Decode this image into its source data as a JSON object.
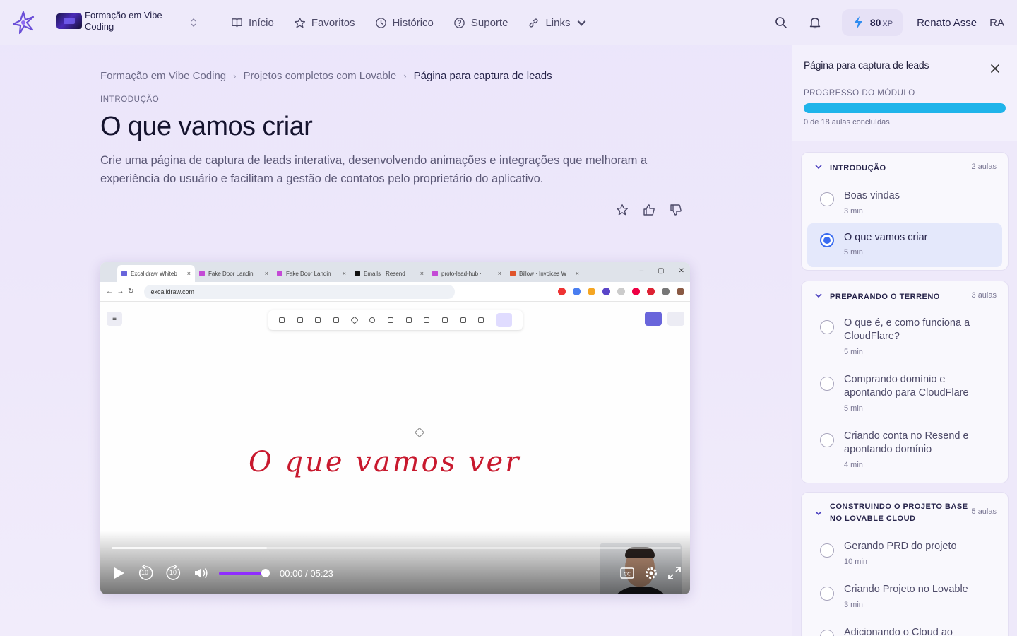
{
  "nav": {
    "course_name": "Formação em Vibe Coding",
    "links": [
      {
        "label": "Início",
        "icon": "book-icon"
      },
      {
        "label": "Favoritos",
        "icon": "star-icon"
      },
      {
        "label": "Histórico",
        "icon": "clock-icon"
      },
      {
        "label": "Suporte",
        "icon": "help-circle-icon"
      },
      {
        "label": "Links",
        "icon": "link-icon"
      }
    ],
    "xp_value": "80",
    "xp_unit": "XP",
    "user_name": "Renato Asse",
    "user_initials": "RA"
  },
  "breadcrumb": [
    "Formação em Vibe Coding",
    "Projetos completos com Lovable",
    "Página para captura de leads"
  ],
  "lesson": {
    "section": "INTRODUÇÃO",
    "title": "O que vamos criar",
    "description": "Crie uma página de captura de leads interativa, desenvolvendo animações e integrações que melhoram a experiência do usuário e facilitam a gestão de contatos pelo proprietário do aplicativo."
  },
  "video": {
    "tabs": [
      "Excalidraw Whiteb",
      "Fake Door Landin",
      "Fake Door Landin",
      "Emails · Resend",
      "proto-lead-hub ·",
      "Billow · Invoices W"
    ],
    "url": "excalidraw.com",
    "canvas_text": "O que vamos ver",
    "time": "00:00 / 05:23",
    "skip_back": "10",
    "skip_forward": "10",
    "played_fraction": 0.0
  },
  "sidebar": {
    "title": "Página para captura de leads",
    "progress_label": "PROGRESSO DO MÓDULO",
    "progress_fraction": 1.0,
    "progress_text": "0 de 18 aulas concluídas",
    "modules": [
      {
        "name": "INTRODUÇÃO",
        "count": "2 aulas",
        "lessons": [
          {
            "title": "Boas vindas",
            "duration": "3 min",
            "active": false
          },
          {
            "title": "O que vamos criar",
            "duration": "5 min",
            "active": true
          }
        ]
      },
      {
        "name": "PREPARANDO O TERRENO",
        "count": "3 aulas",
        "lessons": [
          {
            "title": "O que é, e como funciona a CloudFlare?",
            "duration": "5 min",
            "active": false
          },
          {
            "title": "Comprando domínio e apontando para CloudFlare",
            "duration": "5 min",
            "active": false
          },
          {
            "title": "Criando conta no Resend e apontando domínio",
            "duration": "4 min",
            "active": false
          }
        ]
      },
      {
        "name": "CONSTRUINDO O PROJETO BASE NO LOVABLE CLOUD",
        "count": "5 aulas",
        "lessons": [
          {
            "title": "Gerando PRD do projeto",
            "duration": "10 min",
            "active": false
          },
          {
            "title": "Criando Projeto no Lovable",
            "duration": "3 min",
            "active": false
          },
          {
            "title": "Adicionando o Cloud ao",
            "duration": "",
            "active": false
          }
        ]
      }
    ]
  },
  "colors": {
    "accent": "#3b6cf0",
    "progress": "#1fb4ea",
    "volume": "#8f2cff",
    "canvas_ink": "#c8192e"
  }
}
